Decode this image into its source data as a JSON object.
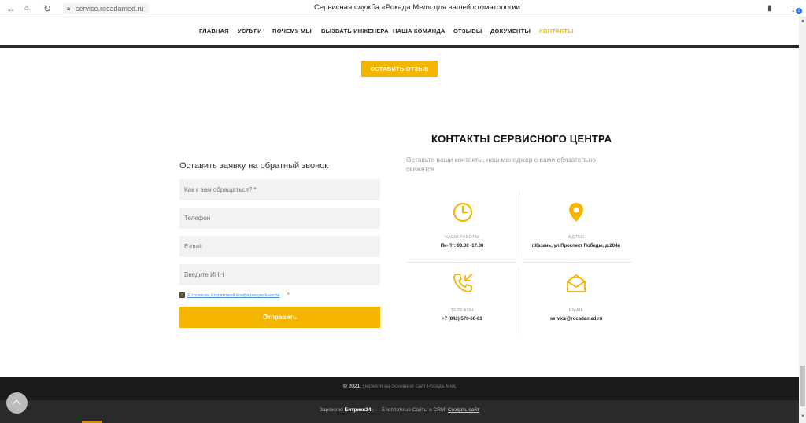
{
  "browser": {
    "url": "service.rocadamed.ru",
    "page_title": "Сервисная служба «Рокада Мед» для вашей стоматологии",
    "badge": "1"
  },
  "nav": {
    "items": [
      {
        "label": "ГЛАВНАЯ"
      },
      {
        "label": "УСЛУГИ"
      },
      {
        "label": "ПОЧЕМУ МЫ"
      },
      {
        "label": "ВЫЗВАТЬ ИНЖЕНЕРА"
      },
      {
        "label": "НАША КОМАНДА"
      },
      {
        "label": "ОТЗЫВЫ"
      },
      {
        "label": "ДОКУМЕНТЫ"
      },
      {
        "label": "КОНТАКТЫ",
        "active": true
      }
    ]
  },
  "review_button": "ОСТАВИТЬ ОТЗЫВ",
  "form": {
    "title": "Оставить заявку на обратный звонок",
    "name_placeholder": "Как к вам обращаться? *",
    "phone_placeholder": "Телефон",
    "email_placeholder": "E-mail",
    "inn_placeholder": "Введите ИНН",
    "consent_text": "Я согласен с политикой конфиденциальности",
    "consent_star": "*",
    "submit": "Отправить"
  },
  "contacts": {
    "title": "КОНТАКТЫ СЕРВИСНОГО ЦЕНТРА",
    "subtitle": "Оставьте ваши контакты, наш менеджер с вами обязательно свяжется",
    "hours": {
      "label": "ЧАСЫ РАБОТЫ",
      "value": "Пн-Пт: 08.00 -17.00",
      "icon": "clock-icon"
    },
    "address": {
      "label": "АДРЕС",
      "value": "г.Казань, ул.Проспект Победы, д.204в",
      "icon": "map-pin-icon"
    },
    "phone": {
      "label": "ТЕЛЕФОН",
      "value": "+7 (843) 570-60-81",
      "icon": "phone-incoming-icon"
    },
    "email": {
      "label": "EMAIL",
      "value": "service@rocadamed.ru",
      "icon": "envelope-icon"
    }
  },
  "footer": {
    "copyright": "© 2021.",
    "main_site_link": "Перейти на основной сайт Рокада Мед",
    "powered_prefix": "Заряжено",
    "bitrix": "Битрикс24",
    "powered_mid": "— Бесплатные Сайты и CRM.",
    "create_site": "Создать сайт"
  },
  "colors": {
    "accent": "#f5b400",
    "footer_dark": "#1a1a1a",
    "footer_darker": "#2a2a2a"
  }
}
